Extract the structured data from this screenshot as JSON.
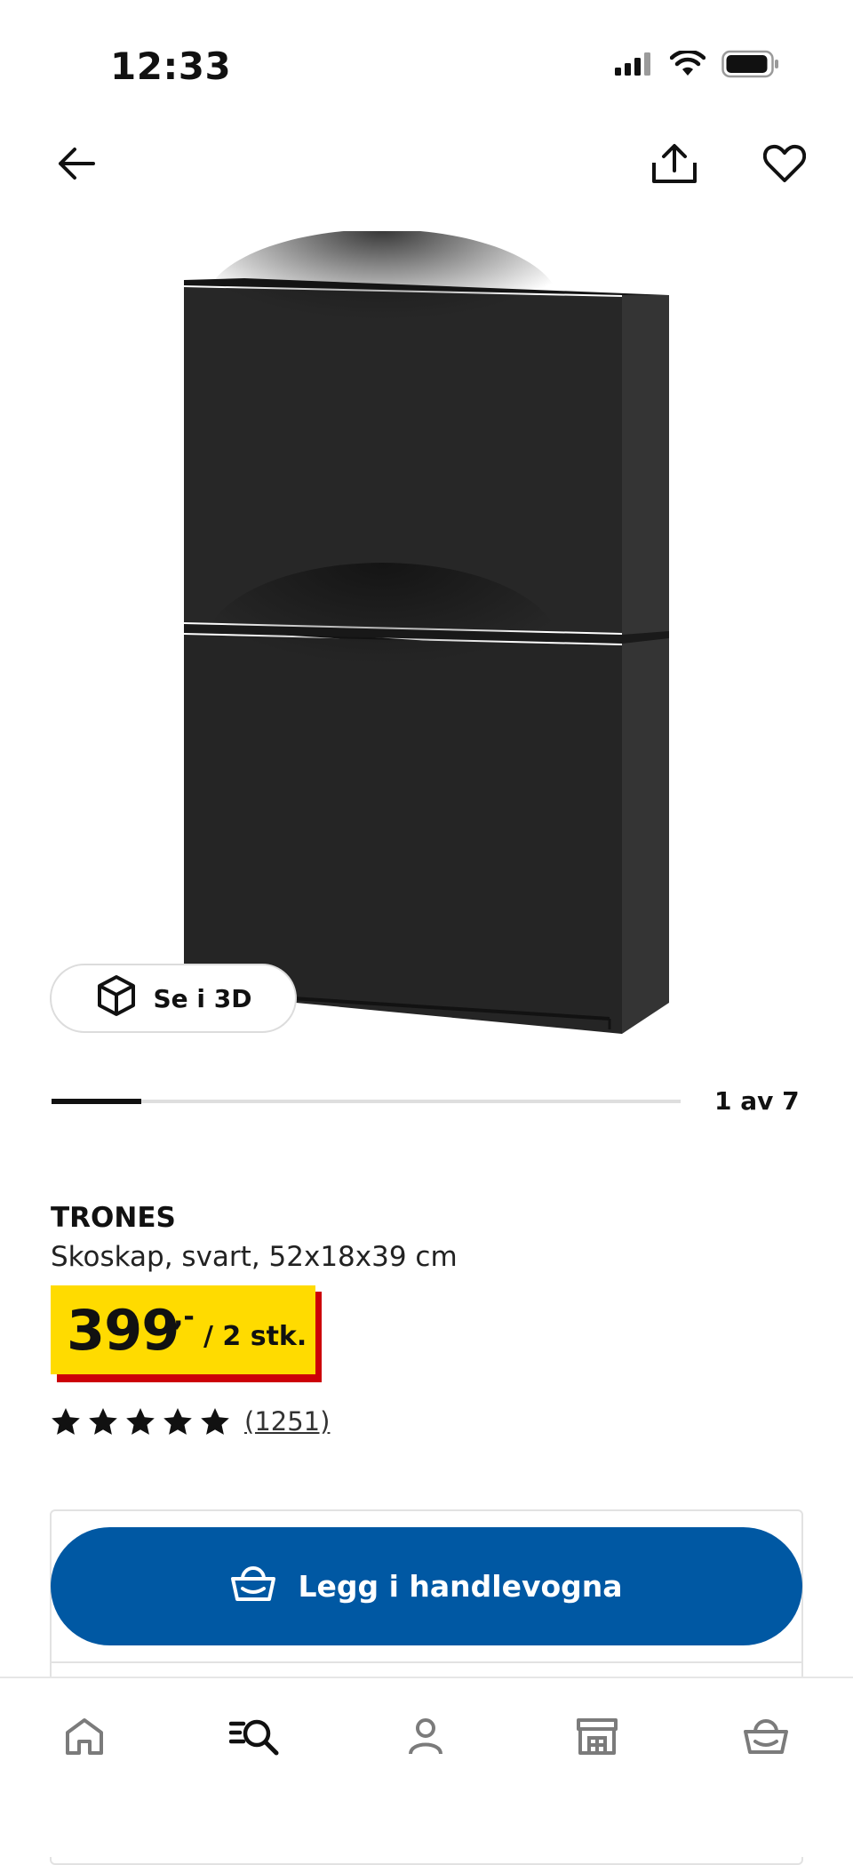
{
  "status_bar": {
    "time": "12:33",
    "icons": [
      "cellular-signal-icon",
      "wifi-icon",
      "battery-icon"
    ]
  },
  "header": {
    "back_icon": "arrow-left-icon",
    "share_icon": "share-icon",
    "favorite_icon": "heart-icon"
  },
  "gallery": {
    "view_3d_label": "Se i 3D",
    "view_3d_icon": "cube-icon",
    "position_label": "1 av 7",
    "current": 1,
    "total": 7
  },
  "product": {
    "name": "TRONES",
    "description": "Skoskap, svart, 52x18x39 cm",
    "price_integer": "399",
    "price_decimal": ",-",
    "price_unit": "/ 2 stk.",
    "rating_stars": 5,
    "review_count": "(1251)"
  },
  "actions": {
    "add_to_cart_label": "Legg i handlevogna",
    "add_to_cart_icon": "basket-icon"
  },
  "bottom_nav": {
    "items": [
      "home-icon",
      "search-icon",
      "profile-icon",
      "store-icon",
      "basket-icon"
    ]
  },
  "colors": {
    "brand_blue": "#0058a3",
    "price_yellow": "#ffdb00",
    "price_red": "#cc0008",
    "product_black": "#252525"
  }
}
